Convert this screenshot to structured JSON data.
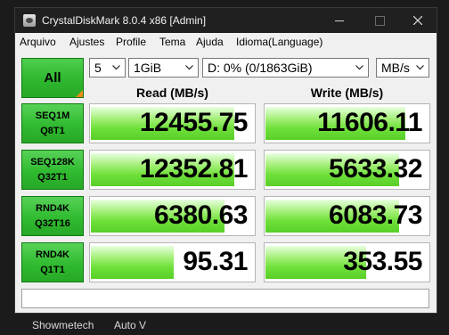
{
  "window": {
    "title": "CrystalDiskMark 8.0.4 x86 [Admin]"
  },
  "menu": [
    {
      "label": "Arquivo"
    },
    {
      "label": "Ajustes"
    },
    {
      "label": "Profile"
    },
    {
      "label": "Tema"
    },
    {
      "label": "Ajuda"
    },
    {
      "label": "Idioma(Language)"
    }
  ],
  "controls": {
    "all_label": "All",
    "count": "5",
    "size": "1GiB",
    "drive": "D: 0% (0/1863GiB)",
    "unit": "MB/s"
  },
  "headers": {
    "read": "Read (MB/s)",
    "write": "Write (MB/s)"
  },
  "results": [
    {
      "name1": "SEQ1M",
      "name2": "Q8T1",
      "read": "12455.75",
      "write": "11606.11",
      "read_fill": 0.87,
      "write_fill": 0.85
    },
    {
      "name1": "SEQ128K",
      "name2": "Q32T1",
      "read": "12352.81",
      "write": "5633.32",
      "read_fill": 0.87,
      "write_fill": 0.81
    },
    {
      "name1": "RND4K",
      "name2": "Q32T16",
      "read": "6380.63",
      "write": "6083.73",
      "read_fill": 0.81,
      "write_fill": 0.81
    },
    {
      "name1": "RND4K",
      "name2": "Q1T1",
      "read": "95.31",
      "write": "353.55",
      "read_fill": 0.5,
      "write_fill": 0.61
    }
  ],
  "comment": "",
  "footer": {
    "left": "Showmetech",
    "right": "Auto V"
  },
  "colors": {
    "accent_green": "#2eb82e",
    "bar_green": "#6fe03a",
    "titlebar": "#202020"
  }
}
